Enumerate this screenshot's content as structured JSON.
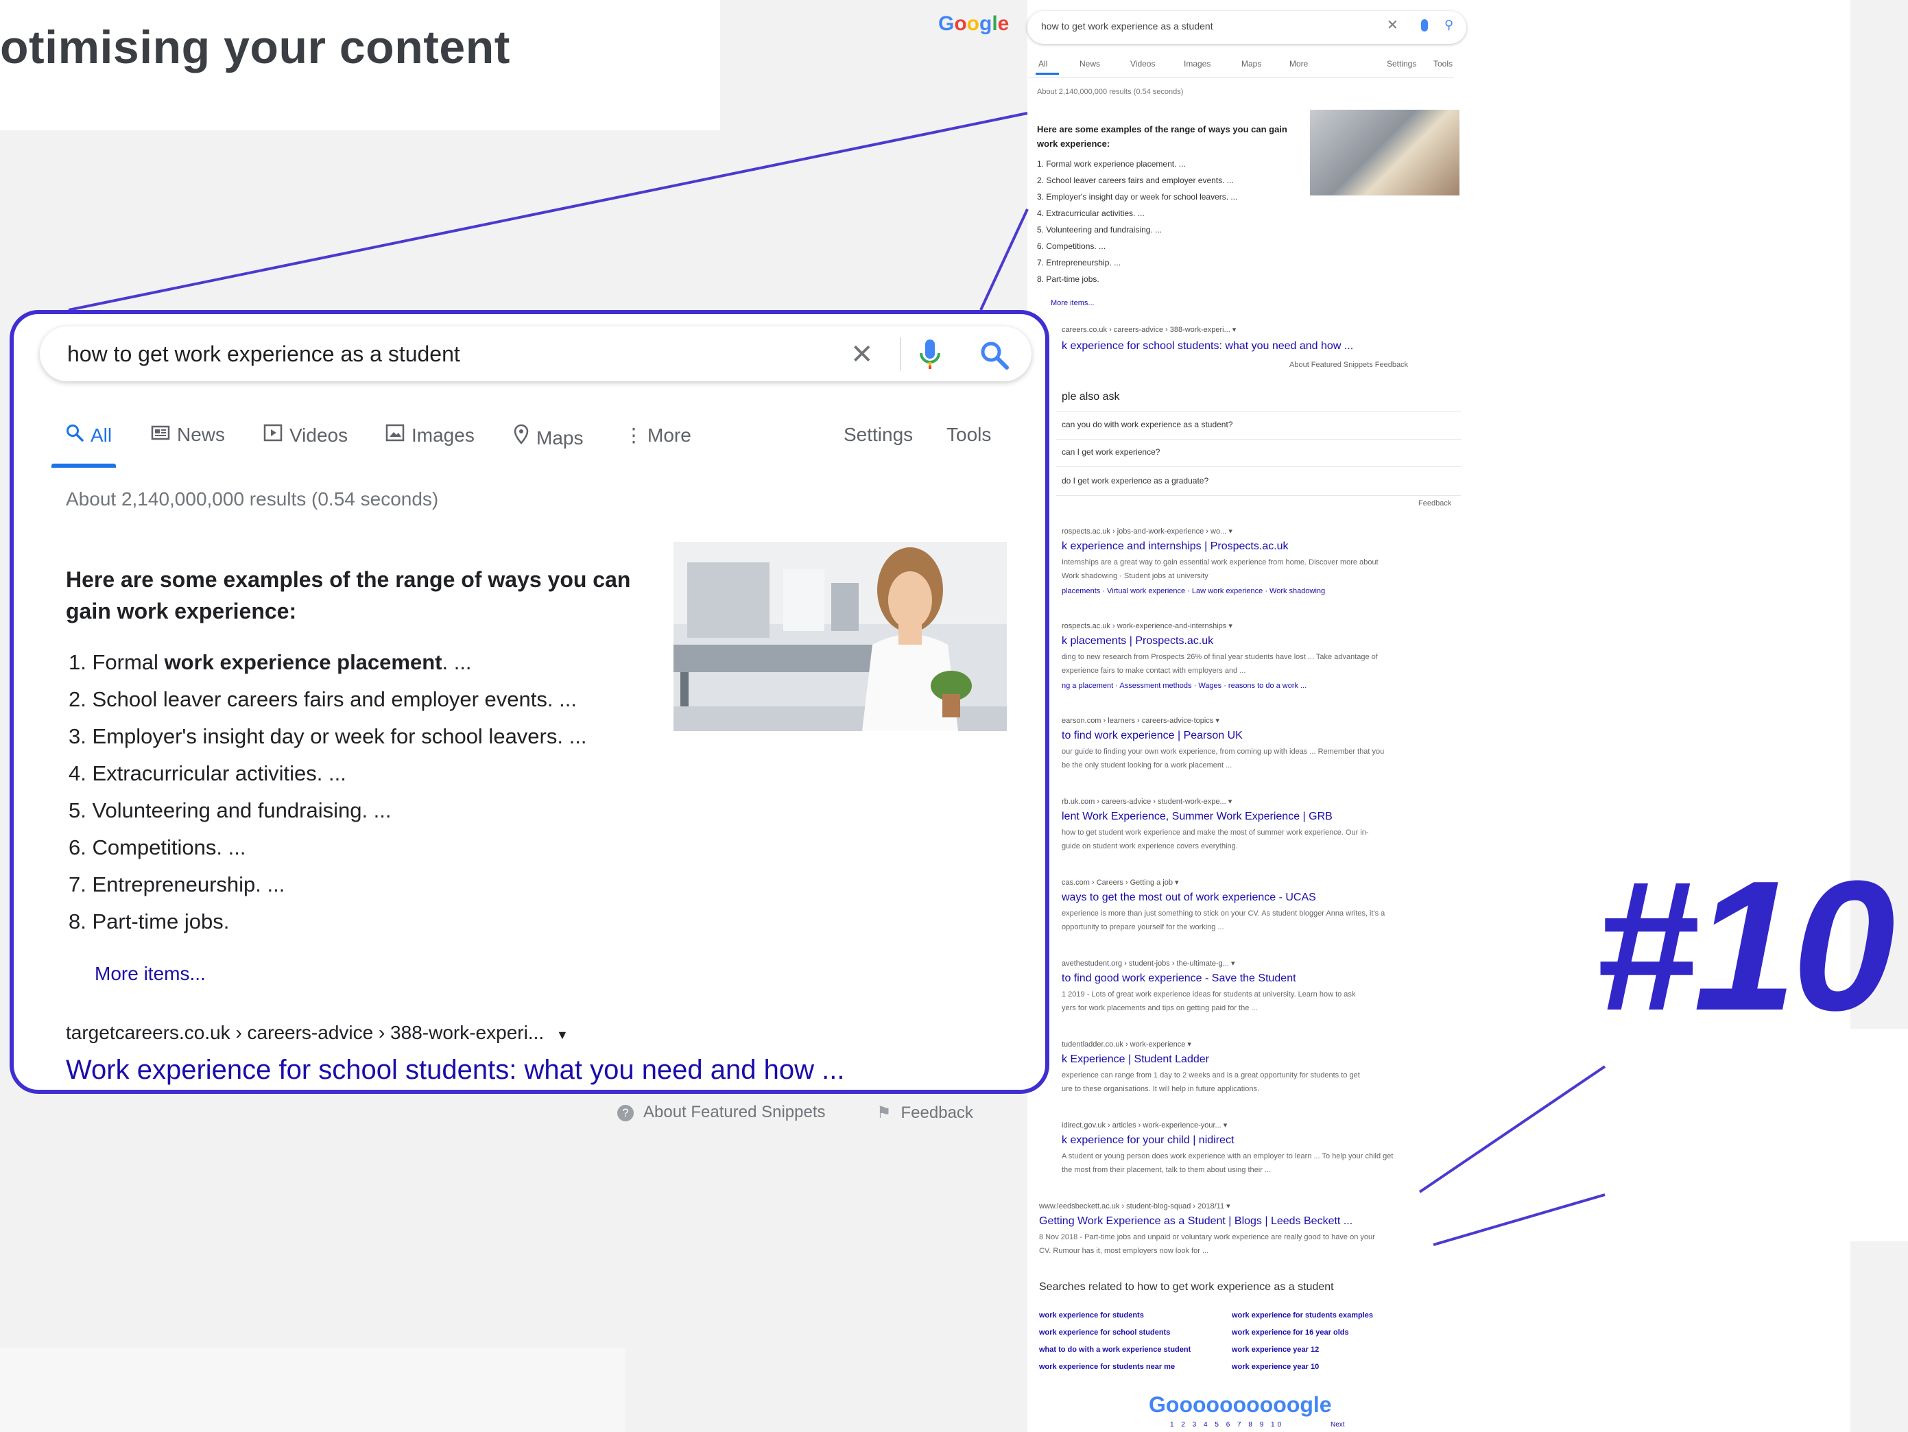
{
  "heading": "otimising your content",
  "rank_label": "#10",
  "zoom": {
    "query": "how to get work experience as a student",
    "tabs": [
      {
        "label": "All"
      },
      {
        "label": "News"
      },
      {
        "label": "Videos"
      },
      {
        "label": "Images"
      },
      {
        "label": "Maps"
      },
      {
        "label": "More"
      },
      {
        "label": "Settings"
      },
      {
        "label": "Tools"
      }
    ],
    "result_stats": "About 2,140,000,000 results (0.54 seconds)",
    "snippet_heading": "Here are some examples of the range of ways you can gain work experience:",
    "list": [
      {
        "num": "1.",
        "pre": "Formal ",
        "bold": "work experience placement",
        "post": ". ..."
      },
      {
        "num": "2.",
        "pre": "School leaver careers fairs and employer events. ...",
        "bold": "",
        "post": ""
      },
      {
        "num": "3.",
        "pre": "Employer's insight day or week for school leavers. ...",
        "bold": "",
        "post": ""
      },
      {
        "num": "4.",
        "pre": "Extracurricular activities. ...",
        "bold": "",
        "post": ""
      },
      {
        "num": "5.",
        "pre": "Volunteering and fundraising. ...",
        "bold": "",
        "post": ""
      },
      {
        "num": "6.",
        "pre": "Competitions. ...",
        "bold": "",
        "post": ""
      },
      {
        "num": "7.",
        "pre": "Entrepreneurship. ...",
        "bold": "",
        "post": ""
      },
      {
        "num": "8.",
        "pre": "Part-time jobs.",
        "bold": "",
        "post": ""
      }
    ],
    "more_items": "More items...",
    "breadcrumb": "targetcareers.co.uk › careers-advice › 388-work-experi...",
    "result_title": "Work experience for school students: what you need and how ...",
    "about_snippets": "About Featured Snippets",
    "feedback": "Feedback"
  },
  "mini": {
    "logo": "Google",
    "query": "how to get work experience as a student",
    "tabs": [
      "All",
      "News",
      "Videos",
      "Images",
      "Maps",
      "More",
      "Settings",
      "Tools"
    ],
    "stats": "About 2,140,000,000 results (0.54 seconds)",
    "snippet_heading": "Here are some examples of the range of ways you can gain work experience:",
    "list": [
      "1. Formal work experience placement. ...",
      "2. School leaver careers fairs and employer events. ...",
      "3. Employer's insight day or week for school leavers. ...",
      "4. Extracurricular activities. ...",
      "5. Volunteering and fundraising. ...",
      "6. Competitions. ...",
      "7. Entrepreneurship. ...",
      "8. Part-time jobs."
    ],
    "more": "More items...",
    "first_crumb": "careers.co.uk › careers-advice › 388-work-experi... ▾",
    "first_link": "k experience for school students: what you need and how ...",
    "first_footer": "About Featured Snippets     Feedback",
    "paa_title": "ple also ask",
    "paa": [
      "can you do with work experience as a student?",
      "can I get work experience?",
      "do I get work experience as a graduate?"
    ],
    "paa_feedback": "Feedback",
    "results": [
      {
        "crumb": "rospects.ac.uk › jobs-and-work-experience › wo... ▾",
        "title": "k experience and internships | Prospects.ac.uk",
        "desc": "Internships are a great way to gain essential work experience from home. Discover more about",
        "desc2": "Work shadowing · Student jobs at university",
        "sub": "placements · Virtual work experience · Law work experience · Work shadowing"
      },
      {
        "crumb": "rospects.ac.uk › work-experience-and-internships ▾",
        "title": "k placements | Prospects.ac.uk",
        "desc": "ding to new research from Prospects 26% of final year students have lost ... Take advantage of",
        "desc2": "experience fairs to make contact with employers and ...",
        "sub": "ng a placement · Assessment methods · Wages · reasons to do a work ..."
      },
      {
        "crumb": "earson.com › learners › careers-advice-topics ▾",
        "title": "to find work experience | Pearson UK",
        "desc": "our guide to finding your own work experience, from coming up with ideas ... Remember that you",
        "desc2": "be the only student looking for a work placement ...",
        "sub": ""
      },
      {
        "crumb": "rb.uk.com › careers-advice › student-work-expe... ▾",
        "title": "lent Work Experience, Summer Work Experience | GRB",
        "desc": "how to get student work experience and make the most of summer work experience. Our in-",
        "desc2": "guide on student work experience covers everything.",
        "sub": ""
      },
      {
        "crumb": "cas.com › Careers › Getting a job ▾",
        "title": "ways to get the most out of work experience - UCAS",
        "desc": "experience is more than just something to stick on your CV. As student blogger Anna writes, it's a",
        "desc2": "opportunity to prepare yourself for the working ...",
        "sub": ""
      },
      {
        "crumb": "avethestudent.org › student-jobs › the-ultimate-g... ▾",
        "title": "to find good work experience - Save the Student",
        "desc": "1 2019 - Lots of great work experience ideas for students at university. Learn how to ask",
        "desc2": "yers for work placements and tips on getting paid for the ...",
        "sub": ""
      },
      {
        "crumb": "tudentladder.co.uk › work-experience ▾",
        "title": "k Experience | Student Ladder",
        "desc": "experience can range from 1 day to 2 weeks and is a great opportunity for students to get",
        "desc2": "ure to these organisations. It will help in future applications.",
        "sub": ""
      },
      {
        "crumb": "idirect.gov.uk › articles › work-experience-your... ▾",
        "title": "k experience for your child | nidirect",
        "desc": "A student or young person does work experience with an employer to learn ... To help your child get",
        "desc2": "the most from their placement, talk to them about using their ...",
        "sub": ""
      },
      {
        "crumb": "www.leedsbeckett.ac.uk › student-blog-squad › 2018/11 ▾",
        "title": "Getting Work Experience as a Student | Blogs | Leeds Beckett ...",
        "desc": "8 Nov 2018 - Part-time jobs and unpaid or voluntary work experience are really good to have on your",
        "desc2": "CV. Rumour has it, most employers now look for ...",
        "sub": ""
      }
    ],
    "related_title": "Searches related to how to get work experience as a student",
    "related": [
      "work experience for students",
      "work experience for students examples",
      "work experience for school students",
      "work experience for 16 year olds",
      "what to do with a work experience student",
      "work experience year 12",
      "work experience for students near me",
      "work experience year 10"
    ],
    "pager_logo": "Goooooooooogle",
    "pager_nums": "1 2 3 4 5 6 7 8 9 10",
    "pager_next": "Next"
  },
  "colors": {
    "accent": "#3f2fd3",
    "rank": "#3127c8",
    "link": "#1a0dab",
    "google_blue": "#1a73e8"
  },
  "icons": [
    "search-icon",
    "close-icon",
    "microphone-icon",
    "news-icon",
    "video-icon",
    "image-icon",
    "map-pin-icon",
    "more-vert-icon",
    "help-circle-icon",
    "flag-icon"
  ]
}
